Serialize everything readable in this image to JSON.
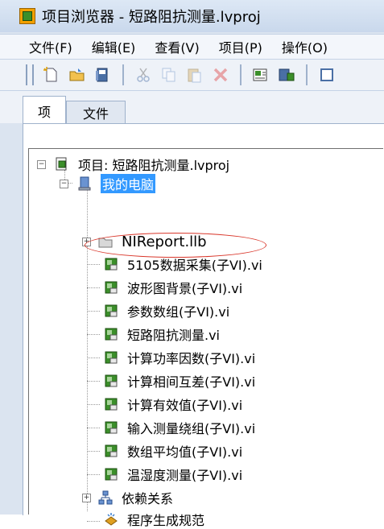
{
  "window": {
    "title": "项目浏览器 - 短路阻抗测量.lvproj"
  },
  "menu": [
    "文件(F)",
    "编辑(E)",
    "查看(V)",
    "项目(P)",
    "操作(O)"
  ],
  "tabs": [
    "项",
    "文件"
  ],
  "tree": {
    "project_label": "项目: 短路阻抗测量.lvproj",
    "computer_label": "我的电脑",
    "library_label": "NIReport.llb",
    "vis": [
      "5105数据采集(子VI).vi",
      "波形图背景(子VI).vi",
      "参数数组(子VI).vi",
      "短路阻抗测量.vi",
      "计算功率因数(子VI).vi",
      "计算相间互差(子VI).vi",
      "计算有效值(子VI).vi",
      "输入测量绕组(子VI).vi",
      "数组平均值(子VI).vi",
      "温湿度测量(子VI).vi"
    ],
    "dependencies_label": "依赖关系",
    "build_label": "程序生成规范"
  },
  "colors": {
    "selection": "#3399ff",
    "annotation": "#d9372b"
  }
}
